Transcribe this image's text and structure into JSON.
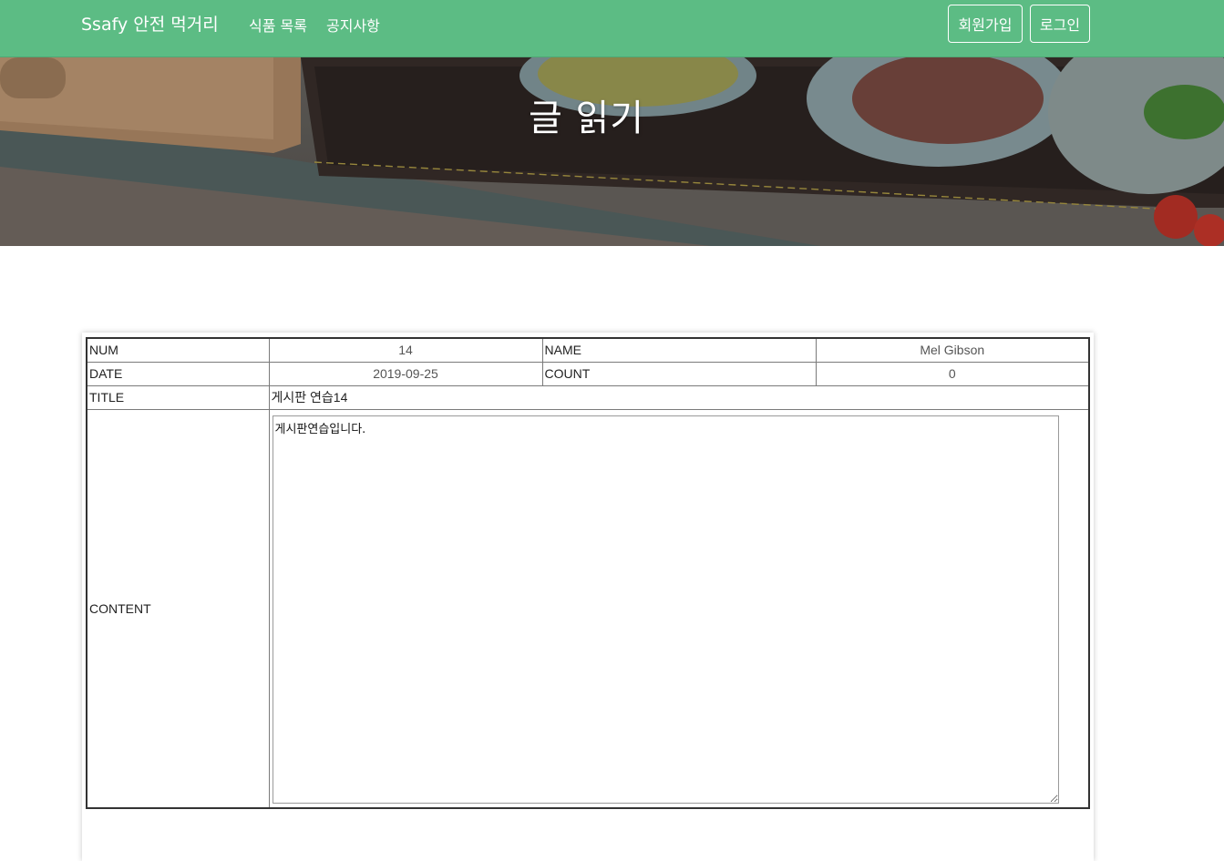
{
  "navbar": {
    "brand": "Ssafy 안전 먹거리",
    "links": [
      "식품 목록",
      "공지사항"
    ],
    "buttons": [
      "회원가입",
      "로그인"
    ],
    "background": "#5cbc84"
  },
  "hero": {
    "title": "글 읽기"
  },
  "post": {
    "num_label": "NUM",
    "num_value": "14",
    "name_label": "NAME",
    "name_value": "Mel Gibson",
    "date_label": "DATE",
    "date_value": "2019-09-25",
    "count_label": "COUNT",
    "count_value": "0",
    "title_label": "TITLE",
    "title_value": "게시판 연습14",
    "content_label": "CONTENT",
    "content_value": "게시판연습입니다."
  }
}
